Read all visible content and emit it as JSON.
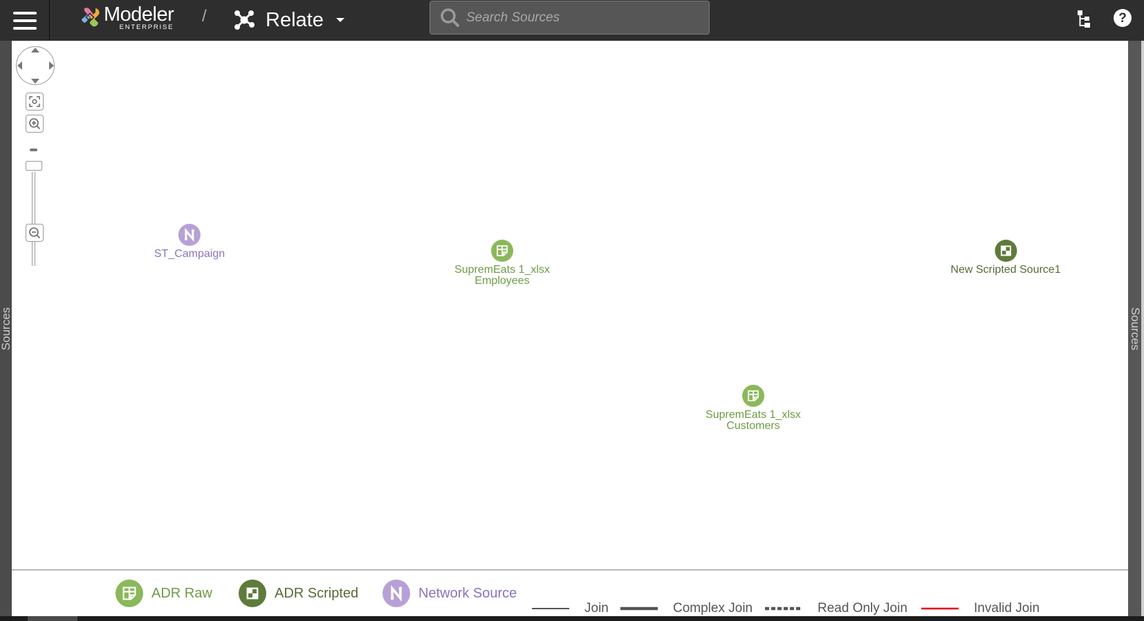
{
  "header": {
    "menu_icon": "hamburger-menu-icon",
    "brand_name": "Modeler",
    "brand_sub": "ENTERPRISE",
    "separator": "/",
    "module_icon": "relate-network-icon",
    "module_title": "Relate",
    "search_placeholder": "Search Sources",
    "search_value": "",
    "right_icons": [
      "hierarchy-tree-icon",
      "help-icon"
    ]
  },
  "sidebars": {
    "left_label": "Sources",
    "right_label": "Sources"
  },
  "canvas_controls": {
    "pan": [
      "up",
      "down",
      "left",
      "right"
    ],
    "fit_icon": "fit-to-screen-icon",
    "zoom_in_icon": "zoom-in-icon",
    "zoom_out_icon": "zoom-out-icon"
  },
  "nodes": [
    {
      "label": [
        "ST_Campaign"
      ],
      "type": "network"
    },
    {
      "label": [
        "SupremEats 1_xlsx",
        "Employees"
      ],
      "type": "adr_raw"
    },
    {
      "label": [
        "New Scripted Source1"
      ],
      "type": "adr_scripted"
    },
    {
      "label": [
        "SupremEats 1_xlsx",
        "Customers"
      ],
      "type": "adr_raw"
    }
  ],
  "legend": {
    "node_types": [
      {
        "label": "ADR Raw",
        "color": "#8bb85a",
        "text_color": "#6e9b44"
      },
      {
        "label": "ADR Scripted",
        "color": "#5e7b3c",
        "text_color": "#556b35"
      },
      {
        "label": "Network Source",
        "color": "#b7a0d6",
        "text_color": "#8c72bd"
      }
    ],
    "join_types": [
      {
        "label": "Join",
        "style": "thin"
      },
      {
        "label": "Complex Join",
        "style": "thick"
      },
      {
        "label": "Read Only Join",
        "style": "dotted"
      },
      {
        "label": "Invalid Join",
        "style": "red",
        "color": "#e8000b"
      }
    ]
  },
  "colors": {
    "header_bg": "#2e2e2e",
    "adr_raw": "#8bb85a",
    "adr_scripted": "#5e7b3c",
    "network": "#b7a0d6",
    "invalid": "#e8000b"
  }
}
